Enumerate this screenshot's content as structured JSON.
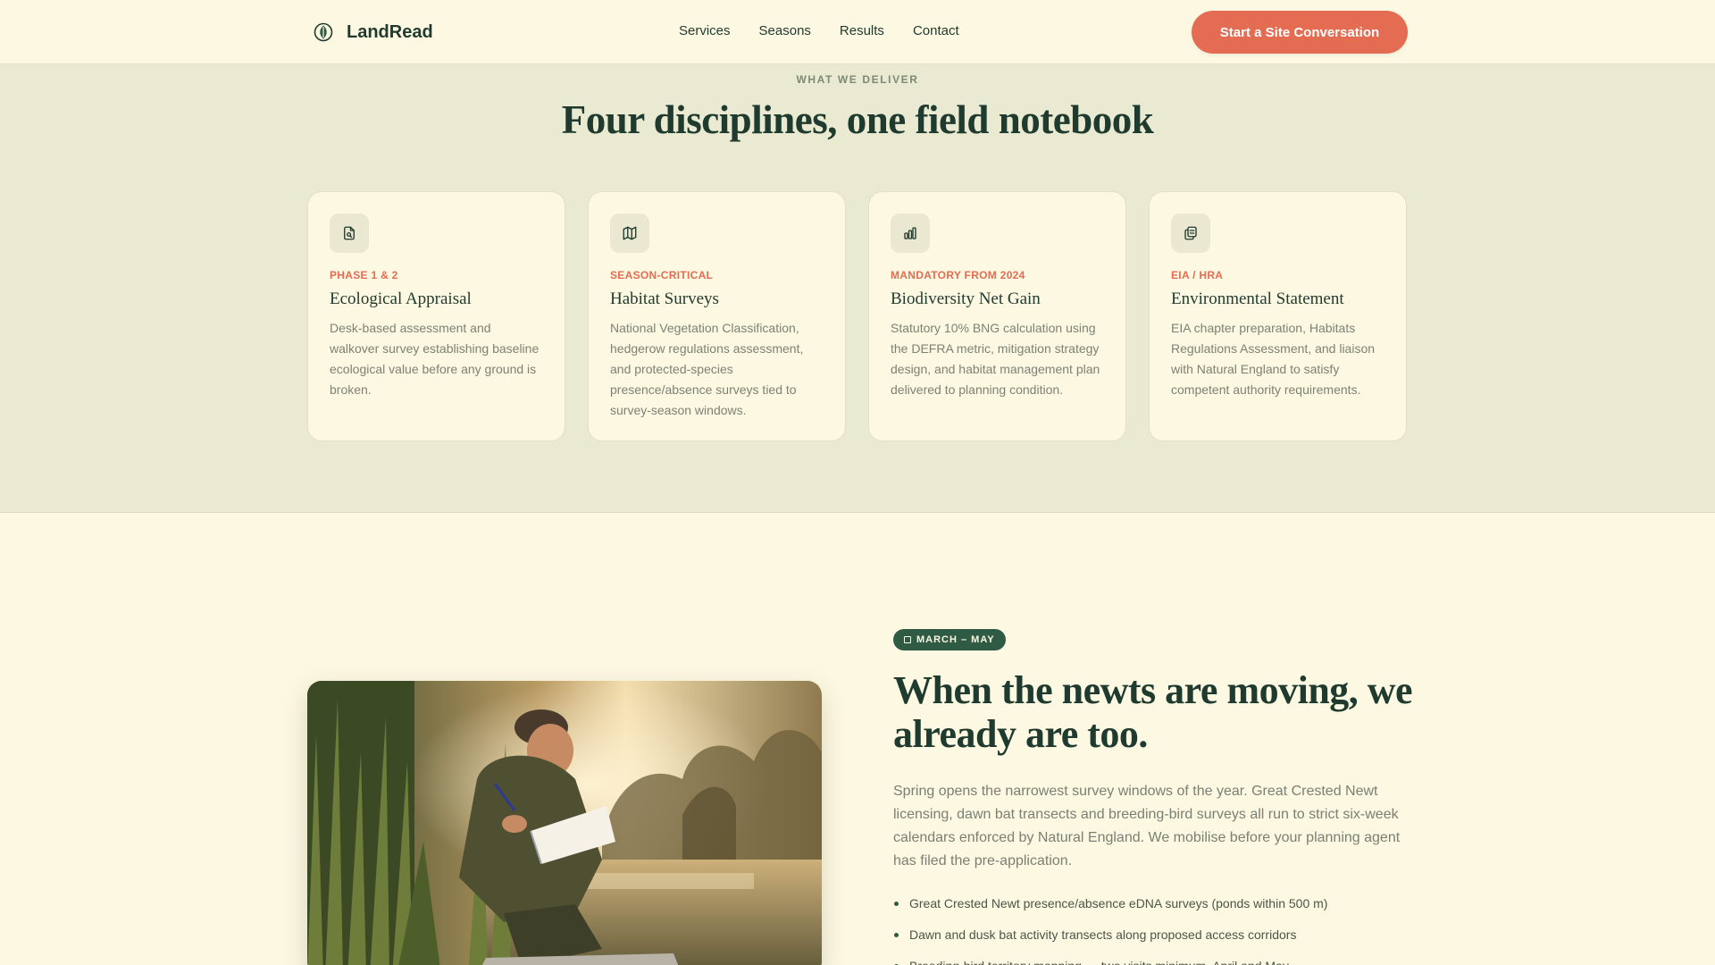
{
  "brand": {
    "name": "LandRead",
    "logo_icon": "leaf-icon"
  },
  "nav": {
    "items": [
      "Services",
      "Seasons",
      "Results",
      "Contact"
    ]
  },
  "header": {
    "cta_label": "Start a Site Conversation"
  },
  "services": {
    "eyebrow": "WHAT WE DELIVER",
    "title": "Four disciplines, one field notebook",
    "cards": [
      {
        "icon": "document-search-icon",
        "tag": "PHASE 1 & 2",
        "title": "Ecological Appraisal",
        "description": "Desk-based assessment and walkover survey establishing baseline ecological value before any ground is broken."
      },
      {
        "icon": "map-icon",
        "tag": "SEASON-CRITICAL",
        "title": "Habitat Surveys",
        "description": "National Vegetation Classification, hedgerow regulations assessment, and protected-species presence/absence surveys tied to survey-season windows."
      },
      {
        "icon": "bar-chart-icon",
        "tag": "MANDATORY FROM 2024",
        "title": "Biodiversity Net Gain",
        "description": "Statutory 10% BNG calculation using the DEFRA metric, mitigation strategy design, and habitat management plan delivered to planning condition."
      },
      {
        "icon": "clipboard-icon",
        "tag": "EIA / HRA",
        "title": "Environmental Statement",
        "description": "EIA chapter preparation, Habitats Regulations Assessment, and liaison with Natural England to satisfy competent authority requirements."
      }
    ]
  },
  "season": {
    "badge": "MARCH – MAY",
    "badge_icon": "calendar-icon",
    "title": "When the newts are moving, we already are too.",
    "lead": "Spring opens the narrowest survey windows of the year. Great Crested Newt licensing, dawn bat transects and breeding-bird surveys all run to strict six-week calendars enforced by Natural England. We mobilise before your planning agent has filed the pre-application.",
    "bullets": [
      "Great Crested Newt presence/absence eDNA surveys (ponds within 500 m)",
      "Dawn and dusk bat activity transects along proposed access corridors",
      "Breeding-bird territory mapping — two visits minimum, April and May"
    ]
  },
  "colors": {
    "accent": "#e36c52",
    "forest": "#1f3a2e",
    "badge": "#2f5b45",
    "cream": "#fdf8e2",
    "band": "#eae9d1"
  }
}
